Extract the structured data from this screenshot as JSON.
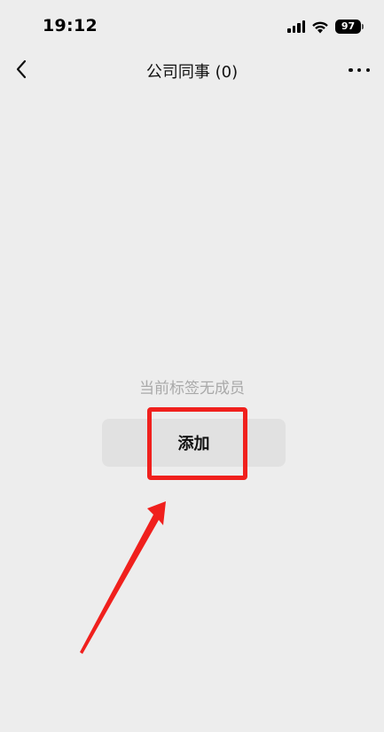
{
  "status_bar": {
    "time": "19:12",
    "battery": "97",
    "icons": [
      "cellular-signal-icon",
      "wifi-icon",
      "battery-icon"
    ]
  },
  "nav": {
    "title": "公司同事 (0)",
    "back_icon": "chevron-left-icon",
    "more_icon": "more-dots-icon"
  },
  "empty_state": {
    "message": "当前标签无成员",
    "add_button_label": "添加"
  },
  "annotation": {
    "highlight_color": "#f0201d",
    "arrow_color": "#f0201d"
  },
  "colors": {
    "background": "#ededed",
    "button_bg": "#e1e1e1",
    "muted_text": "#a9a9a9"
  }
}
